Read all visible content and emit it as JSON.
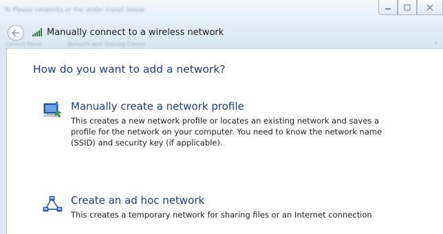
{
  "window": {
    "blurred_title": "To Please networks or the under Install below",
    "blurred_breadcrumb_1": "Control Panel",
    "blurred_breadcrumb_2": "Network and Sharing Center"
  },
  "header": {
    "title": "Manually connect to a wireless network"
  },
  "main": {
    "question": "How do you want to add a network?",
    "options": [
      {
        "title": "Manually create a network profile",
        "description": "This creates a new network profile or locates an existing network and saves a profile for the network on your computer. You need to know the network name (SSID) and security key (if applicable).",
        "icon": "network-profile-icon"
      },
      {
        "title": "Create an ad hoc network",
        "description": "This creates a temporary network for sharing files or an Internet connection",
        "icon": "ad-hoc-network-icon"
      }
    ]
  },
  "colors": {
    "link_blue": "#1d3a8a",
    "frame": "#dfe8f2",
    "content_bg": "#ffffff"
  }
}
